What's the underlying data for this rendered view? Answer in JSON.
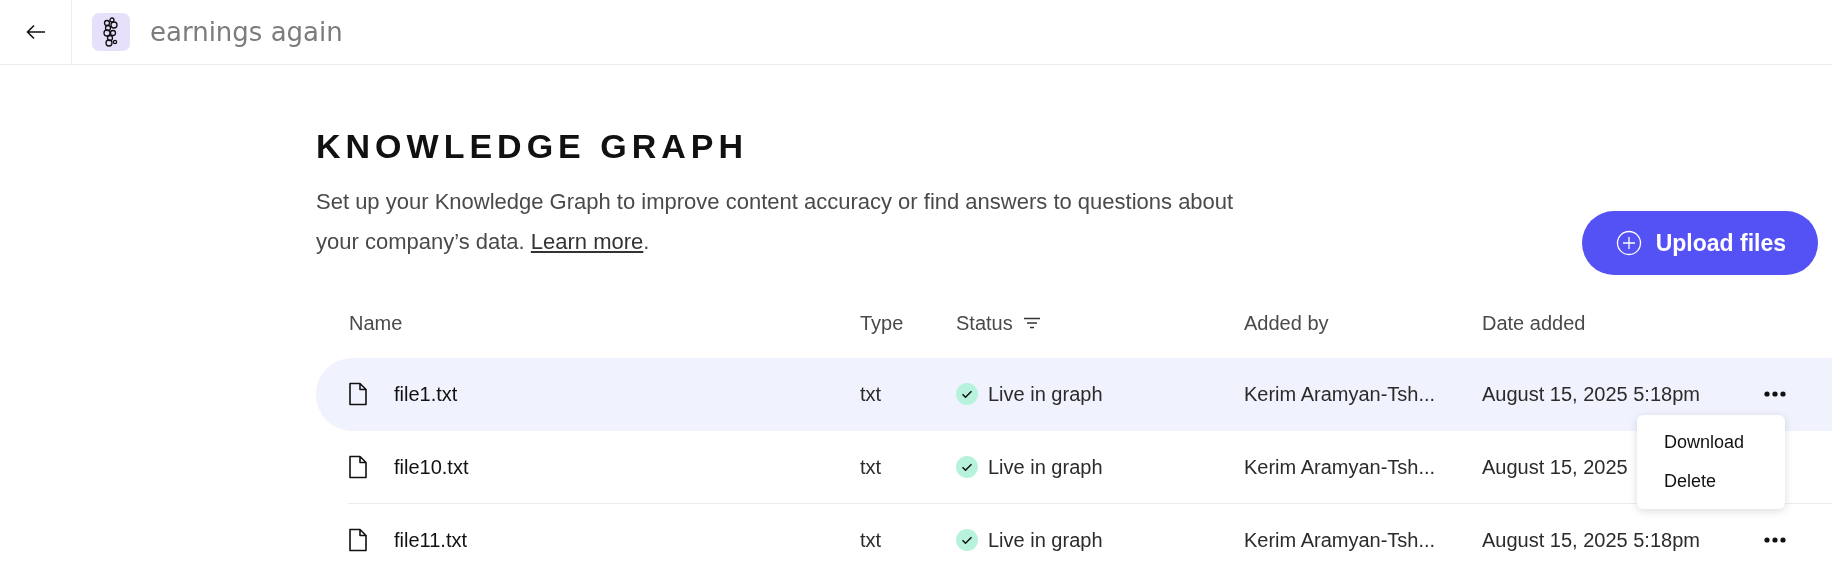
{
  "header": {
    "title": "earnings again"
  },
  "page": {
    "heading": "KNOWLEDGE GRAPH",
    "description_before": "Set up your Knowledge Graph to improve content accuracy or find answers to questions about your company’s data. ",
    "link": "Learn more",
    "description_after": "."
  },
  "upload_button": {
    "label": "Upload files"
  },
  "table": {
    "columns": [
      {
        "label": "Name",
        "filter": false
      },
      {
        "label": "Type",
        "filter": false
      },
      {
        "label": "Status",
        "filter": true
      },
      {
        "label": "Added by",
        "filter": false
      },
      {
        "label": "Date added",
        "filter": false
      }
    ],
    "rows": [
      {
        "name": "file1.txt",
        "type": "txt",
        "status": "Live in graph",
        "added_by": "Kerim Aramyan-Tsh...",
        "date": "August 15, 2025 5:18pm",
        "selected": true,
        "show_actions": true
      },
      {
        "name": "file10.txt",
        "type": "txt",
        "status": "Live in graph",
        "added_by": "Kerim Aramyan-Tsh...",
        "date": "August 15, 2025",
        "selected": false,
        "show_actions": false
      },
      {
        "name": "file11.txt",
        "type": "txt",
        "status": "Live in graph",
        "added_by": "Kerim Aramyan-Tsh...",
        "date": "August 15, 2025 5:18pm",
        "selected": false,
        "show_actions": true
      }
    ]
  },
  "row_menu": {
    "items": [
      "Download",
      "Delete"
    ]
  }
}
